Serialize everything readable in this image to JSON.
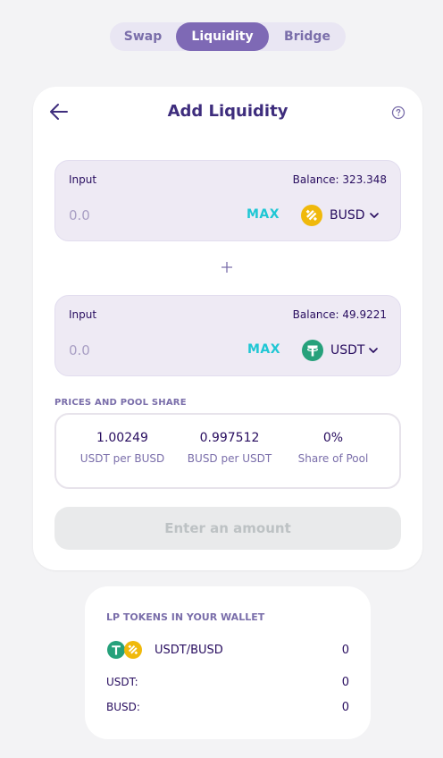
{
  "tabs": [
    {
      "label": "Swap"
    },
    {
      "label": "Liquidity"
    },
    {
      "label": "Bridge"
    }
  ],
  "card": {
    "title": "Add Liquidity"
  },
  "input_a": {
    "label": "Input",
    "balance": "Balance: 323.348",
    "placeholder": "0.0",
    "max_label": "MAX",
    "currency": "BUSD",
    "icon": "busd-icon",
    "color": "#f0b90b"
  },
  "input_b": {
    "label": "Input",
    "balance": "Balance: 49.9221",
    "placeholder": "0.0",
    "max_label": "MAX",
    "currency": "USDT",
    "icon": "usdt-icon",
    "color": "#26a17b"
  },
  "prices": {
    "section_label": "PRICES AND POOL SHARE",
    "items": [
      {
        "value": "1.00249",
        "label": "USDT per BUSD"
      },
      {
        "value": "0.997512",
        "label": "BUSD per USDT"
      },
      {
        "value": "0%",
        "label": "Share of Pool"
      }
    ]
  },
  "action_button": "Enter an amount",
  "lp": {
    "title": "LP TOKENS IN YOUR WALLET",
    "pair": "USDT/BUSD",
    "pair_value": "0",
    "rows": [
      {
        "label": "USDT:",
        "value": "0"
      },
      {
        "label": "BUSD:",
        "value": "0"
      }
    ]
  },
  "colors": {
    "accent": "#7e69b5",
    "cyan": "#1fc7d4",
    "text": "#280d5f"
  }
}
